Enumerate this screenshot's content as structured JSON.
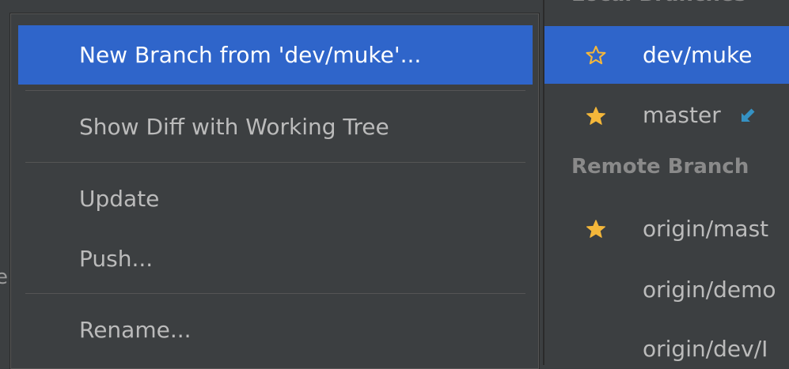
{
  "background": {
    "clipped_text": "e"
  },
  "context_menu": {
    "items": [
      {
        "label": "New Branch from 'dev/muke'...",
        "selected": true
      },
      {
        "label": "Show Diff with Working Tree",
        "selected": false
      },
      {
        "label": "Update",
        "selected": false
      },
      {
        "label": "Push...",
        "selected": false
      },
      {
        "label": "Rename...",
        "selected": false
      }
    ]
  },
  "branches": {
    "local_header": "Local Branches",
    "remote_header": "Remote Branch",
    "local": [
      {
        "label": "dev/muke",
        "icon": "star-outline-icon",
        "selected": true
      },
      {
        "label": "master",
        "icon": "star-filled-icon",
        "selected": false,
        "badge_icon": "incoming-arrow-icon"
      }
    ],
    "remote": [
      {
        "label": "origin/mast",
        "icon": "star-filled-icon"
      },
      {
        "label": "origin/demo",
        "icon": ""
      },
      {
        "label": "origin/dev/I",
        "icon": ""
      }
    ]
  },
  "colors": {
    "background": "#3c3f41",
    "selection": "#2f65ca",
    "text": "#bbbbbb",
    "star": "#f4b73a",
    "arrow": "#3592c4"
  }
}
